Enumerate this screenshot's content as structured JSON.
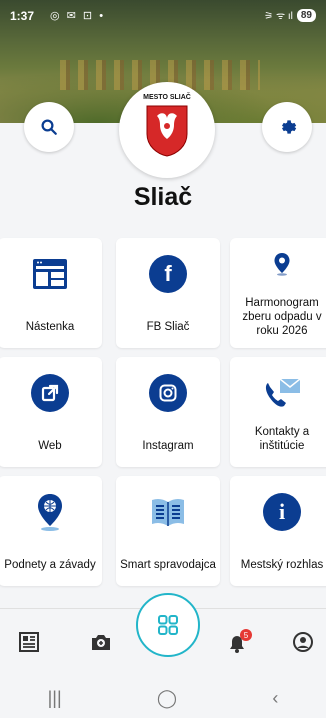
{
  "status_bar": {
    "time": "1:37",
    "battery": "89",
    "left_glyphs": "◎ ✉ ⊡ •",
    "right_glyphs": "⚞ ᯤ ıl"
  },
  "header": {
    "logo_text": "MESTO SLIAČ",
    "city_name": "Sliač"
  },
  "tiles": [
    {
      "label": "Nástenka",
      "icon": "board-icon"
    },
    {
      "label": "FB Sliač",
      "icon": "facebook-icon"
    },
    {
      "label": "Harmonogram zberu odpadu v roku 2026",
      "icon": "location-pin-icon"
    },
    {
      "label": "Web",
      "icon": "external-link-icon"
    },
    {
      "label": "Instagram",
      "icon": "instagram-icon"
    },
    {
      "label": "Kontakty a inštitúcie",
      "icon": "phone-icon"
    },
    {
      "label": "Podnety a závady",
      "icon": "map-pin-globe-icon"
    },
    {
      "label": "Smart spravodajca",
      "icon": "newspaper-icon"
    },
    {
      "label": "Mestský rozhlas",
      "icon": "info-icon"
    }
  ],
  "bottom_nav": {
    "notification_count": "5"
  },
  "colors": {
    "primary": "#0b3d91",
    "accent": "#22b5c9",
    "badge": "#e53935"
  }
}
